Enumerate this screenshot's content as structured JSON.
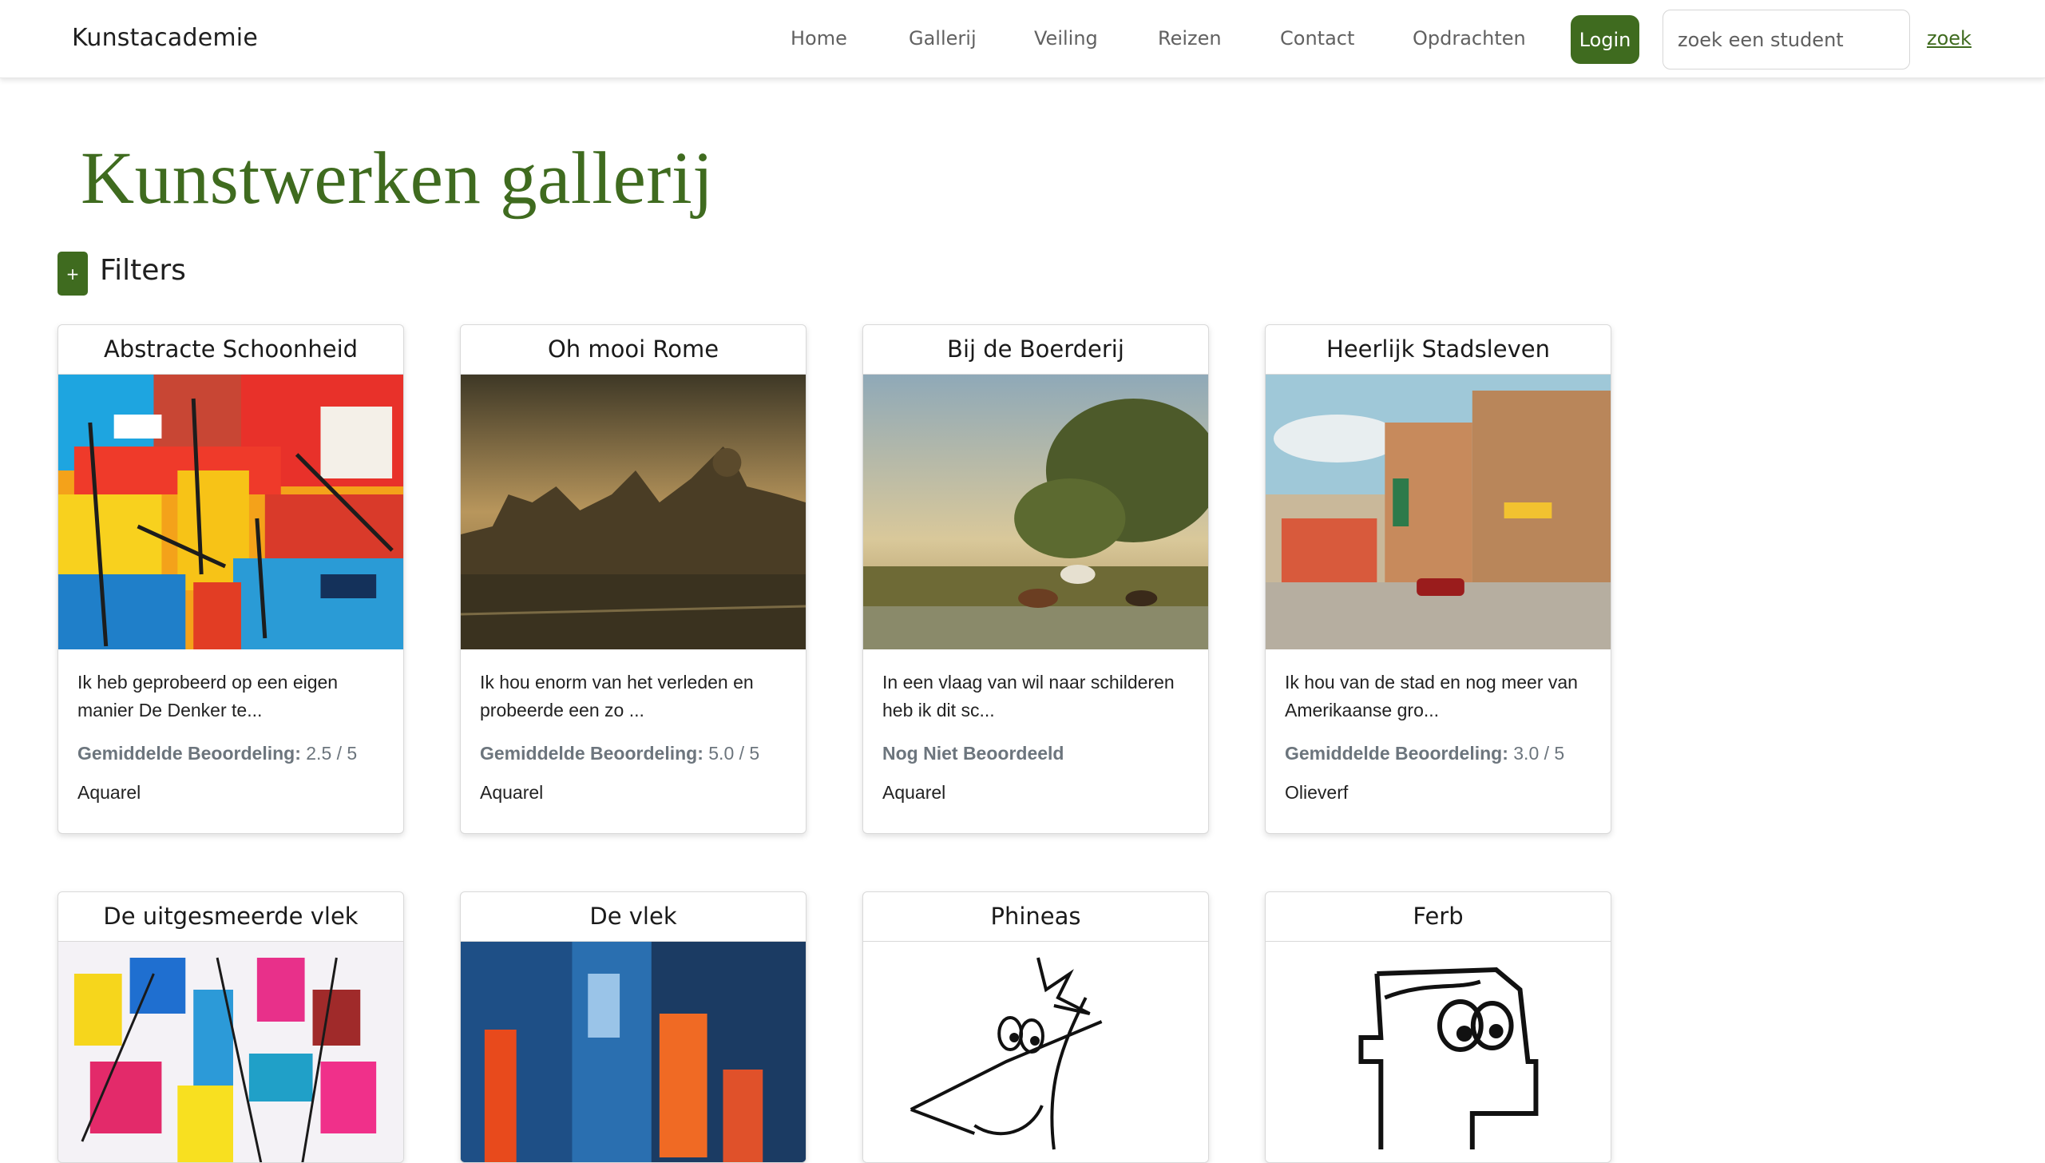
{
  "nav": {
    "brand": "Kunstacademie",
    "links": [
      "Home",
      "Gallerij",
      "Veiling",
      "Reizen",
      "Contact",
      "Opdrachten"
    ],
    "login_label": "Login",
    "search_placeholder": "zoek een student",
    "search_label": "zoek"
  },
  "page": {
    "title": "Kunstwerken gallerij",
    "filters_button": "+",
    "filters_label": "Filters"
  },
  "cards": [
    {
      "title": "Abstracte Schoonheid",
      "description": "Ik heb geprobeerd op een eigen manier De Denker te...",
      "rating_label": "Gemiddelde Beoordeling:",
      "rating_value": "2.5 / 5",
      "medium": "Aquarel"
    },
    {
      "title": "Oh mooi Rome",
      "description": "Ik hou enorm van het verleden en probeerde een zo ...",
      "rating_label": "Gemiddelde Beoordeling:",
      "rating_value": "5.0 / 5",
      "medium": "Aquarel"
    },
    {
      "title": "Bij de Boerderij",
      "description": "In een vlaag van wil naar schilderen heb ik dit sc...",
      "rating_label": "Nog Niet Beoordeeld",
      "rating_value": "",
      "medium": "Aquarel"
    },
    {
      "title": "Heerlijk Stadsleven",
      "description": "Ik hou van de stad en nog meer van Amerikaanse gro...",
      "rating_label": "Gemiddelde Beoordeling:",
      "rating_value": "3.0 / 5",
      "medium": "Olieverf"
    },
    {
      "title": "De uitgesmeerde vlek"
    },
    {
      "title": "De vlek"
    },
    {
      "title": "Phineas"
    },
    {
      "title": "Ferb"
    }
  ],
  "colors": {
    "accent": "#3f6b1f",
    "muted_text": "#6c757d",
    "card_border": "#d9d9d9"
  }
}
